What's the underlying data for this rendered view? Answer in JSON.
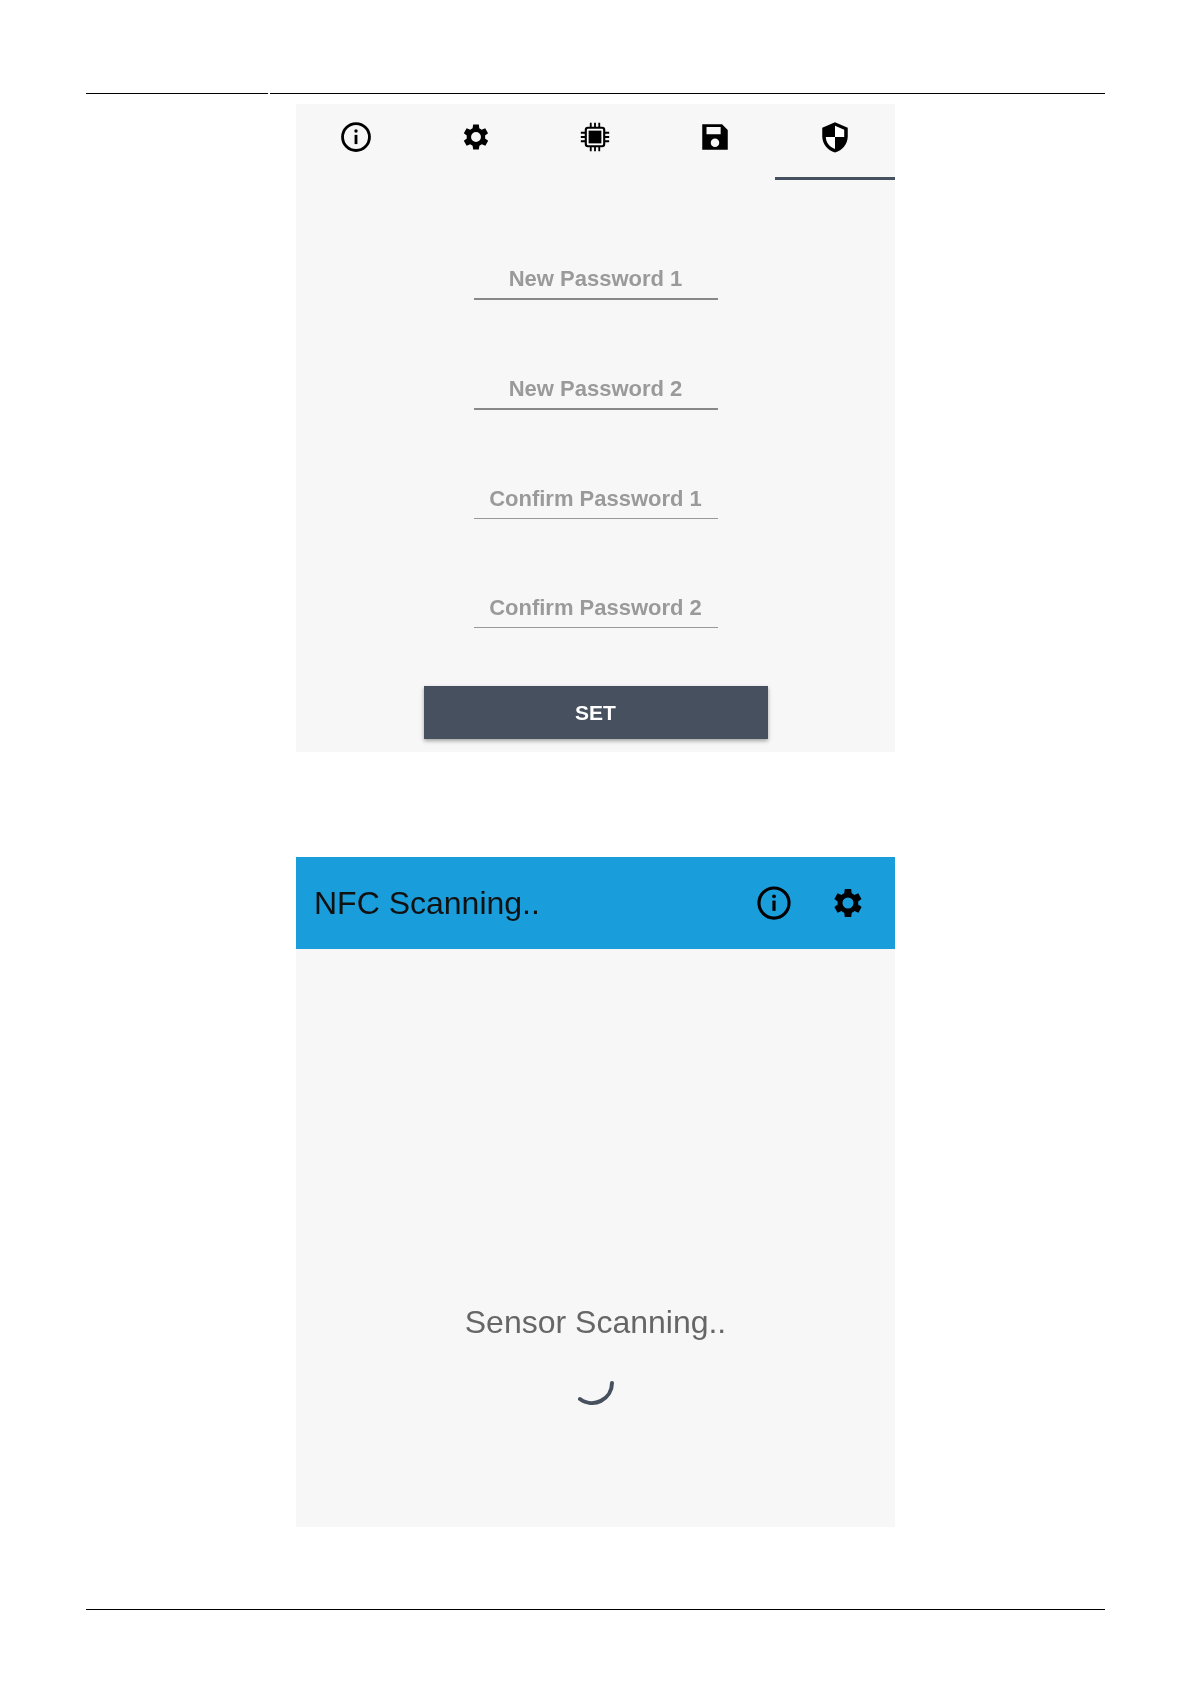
{
  "settings_screen": {
    "tabs": [
      {
        "kind": "info",
        "selected": false
      },
      {
        "kind": "gear",
        "selected": false
      },
      {
        "kind": "chip",
        "selected": false
      },
      {
        "kind": "save",
        "selected": false
      },
      {
        "kind": "shield",
        "selected": true
      }
    ],
    "fields": [
      {
        "placeholder": "New Password 1"
      },
      {
        "placeholder": "New Password 2"
      },
      {
        "placeholder": "Confirm Password 1"
      },
      {
        "placeholder": "Confirm Password 2"
      }
    ],
    "button": "SET"
  },
  "scan_screen": {
    "app_bar": {
      "title": "NFC Scanning..",
      "actions": [
        {
          "kind": "info"
        },
        {
          "kind": "gear"
        }
      ]
    },
    "status": "Sensor Scanning.."
  }
}
